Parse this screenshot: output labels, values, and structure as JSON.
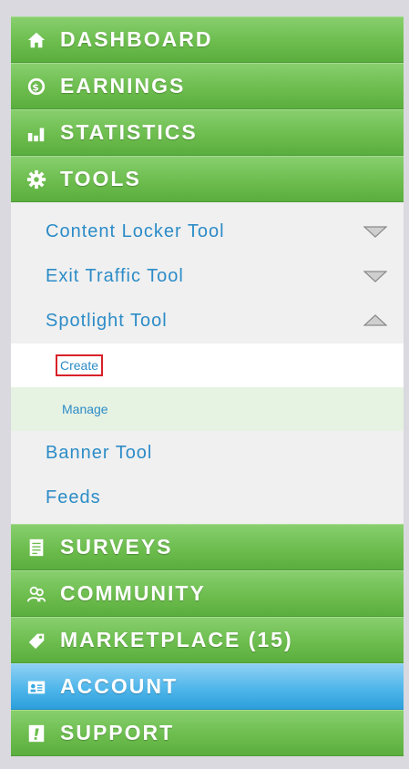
{
  "menu": {
    "dashboard": "DASHBOARD",
    "earnings": "EARNINGS",
    "statistics": "STATISTICS",
    "tools": "TOOLS",
    "surveys": "SURVEYS",
    "community": "COMMUNITY",
    "marketplace": "MARKETPLACE (15)",
    "account": "ACCOUNT",
    "support": "SUPPORT"
  },
  "tools_submenu": {
    "content_locker": "Content Locker Tool",
    "exit_traffic": "Exit Traffic Tool",
    "spotlight": "Spotlight Tool",
    "spotlight_children": {
      "create": "Create",
      "manage": "Manage"
    },
    "banner": "Banner Tool",
    "feeds": "Feeds"
  },
  "icons": {
    "dashboard": "home-icon",
    "earnings": "money-icon",
    "statistics": "bar-chart-icon",
    "tools": "gear-icon",
    "surveys": "document-icon",
    "community": "people-icon",
    "marketplace": "tag-icon",
    "account": "id-card-icon",
    "support": "help-icon"
  },
  "colors": {
    "menu_green": "#6dbd4e",
    "active_blue": "#4fb6ea",
    "link_blue": "#2c8cc7",
    "highlight_red": "#d8212a"
  }
}
